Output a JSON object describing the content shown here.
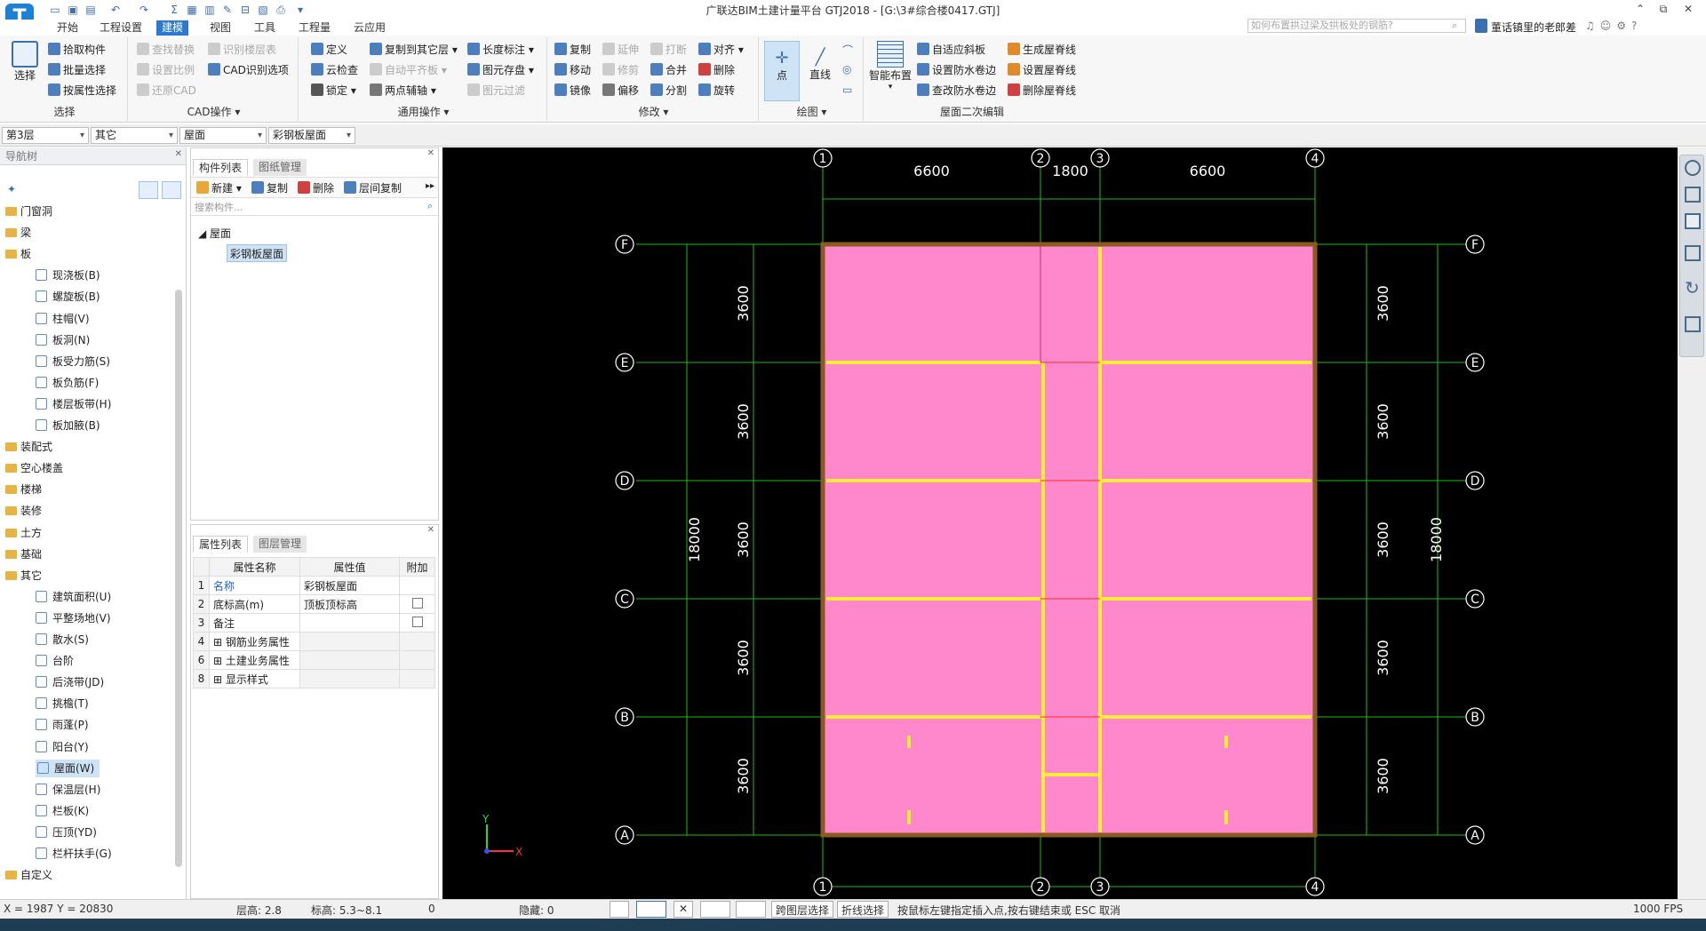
{
  "window": {
    "title": "广联达BIM土建计量平台 GTJ2018 - [G:\\3#综合楼0417.GTJ]"
  },
  "menu": [
    "开始",
    "工程设置",
    "建模",
    "视图",
    "工具",
    "工程量",
    "云应用"
  ],
  "menu_active_index": 2,
  "search": {
    "placeholder": "如何布置拱过梁及拱板处的钢筋?"
  },
  "user": {
    "name": "董话镇里的老郎差"
  },
  "ribbon": {
    "select": {
      "label": "选择",
      "big": "选择",
      "items": [
        "拾取构件",
        "批量选择",
        "按属性选择"
      ]
    },
    "cad": {
      "label": "CAD操作",
      "items": [
        "查找替换",
        "设置比例",
        "还原CAD",
        "识别楼层表",
        "CAD识别选项"
      ]
    },
    "common": {
      "label": "通用操作",
      "items": [
        "定义",
        "云检查",
        "锁定",
        "复制到其它层",
        "自动平齐板",
        "两点辅轴",
        "长度标注",
        "图元存盘",
        "图元过滤"
      ]
    },
    "modify": {
      "label": "修改",
      "items": [
        "复制",
        "移动",
        "镜像",
        "延伸",
        "修剪",
        "偏移",
        "打断",
        "合并",
        "分割",
        "对齐",
        "删除",
        "旋转"
      ]
    },
    "draw": {
      "label": "绘图",
      "items": [
        "点",
        "直线"
      ]
    },
    "roof": {
      "label": "屋面二次编辑",
      "items": [
        "智能布置",
        "自适应斜板",
        "设置防水卷边",
        "查改防水卷边",
        "生成屋脊线",
        "设置屋脊线",
        "删除屋脊线"
      ]
    }
  },
  "filters": [
    "第3层",
    "其它",
    "屋面",
    "彩钢板屋面"
  ],
  "nav": {
    "title": "导航树",
    "items": [
      {
        "t": "folder",
        "label": "门窗洞"
      },
      {
        "t": "folder",
        "label": "梁"
      },
      {
        "t": "folder",
        "label": "板"
      },
      {
        "t": "leaf",
        "label": "现浇板(B)"
      },
      {
        "t": "leaf",
        "label": "螺旋板(B)"
      },
      {
        "t": "leaf",
        "label": "柱帽(V)"
      },
      {
        "t": "leaf",
        "label": "板洞(N)"
      },
      {
        "t": "leaf",
        "label": "板受力筋(S)"
      },
      {
        "t": "leaf",
        "label": "板负筋(F)"
      },
      {
        "t": "leaf",
        "label": "楼层板带(H)"
      },
      {
        "t": "leaf",
        "label": "板加腋(B)"
      },
      {
        "t": "folder",
        "label": "装配式"
      },
      {
        "t": "folder",
        "label": "空心楼盖"
      },
      {
        "t": "folder",
        "label": "楼梯"
      },
      {
        "t": "folder",
        "label": "装修"
      },
      {
        "t": "folder",
        "label": "土方"
      },
      {
        "t": "folder",
        "label": "基础"
      },
      {
        "t": "folder",
        "label": "其它"
      },
      {
        "t": "leaf",
        "label": "建筑面积(U)"
      },
      {
        "t": "leaf",
        "label": "平整场地(V)"
      },
      {
        "t": "leaf",
        "label": "散水(S)"
      },
      {
        "t": "leaf",
        "label": "台阶"
      },
      {
        "t": "leaf",
        "label": "后浇带(JD)"
      },
      {
        "t": "leaf",
        "label": "挑檐(T)"
      },
      {
        "t": "leaf",
        "label": "雨蓬(P)"
      },
      {
        "t": "leaf",
        "label": "阳台(Y)"
      },
      {
        "t": "leaf",
        "label": "屋面(W)",
        "selected": true
      },
      {
        "t": "leaf",
        "label": "保温层(H)"
      },
      {
        "t": "leaf",
        "label": "栏板(K)"
      },
      {
        "t": "leaf",
        "label": "压顶(YD)"
      },
      {
        "t": "leaf",
        "label": "栏杆扶手(G)"
      },
      {
        "t": "folder",
        "label": "自定义"
      }
    ]
  },
  "components": {
    "tabs": [
      "构件列表",
      "图纸管理"
    ],
    "toolbar": [
      "新建",
      "复制",
      "删除",
      "层间复制"
    ],
    "search_placeholder": "搜索构件...",
    "group": "屋面",
    "selected": "彩钢板屋面"
  },
  "attributes": {
    "tabs": [
      "属性列表",
      "图层管理"
    ],
    "headers": [
      "属性名称",
      "属性值",
      "附加"
    ],
    "rows": [
      {
        "n": "1",
        "name": "名称",
        "value": "彩钢板屋面",
        "check": false,
        "blue": true
      },
      {
        "n": "2",
        "name": "底标高(m)",
        "value": "顶板顶标高",
        "check": true
      },
      {
        "n": "3",
        "name": "备注",
        "value": "",
        "check": true
      },
      {
        "n": "4",
        "name": "钢筋业务属性",
        "value": "",
        "check": false,
        "expand": true
      },
      {
        "n": "6",
        "name": "土建业务属性",
        "value": "",
        "check": false,
        "expand": true
      },
      {
        "n": "8",
        "name": "显示样式",
        "value": "",
        "check": false,
        "expand": true
      }
    ]
  },
  "drawing": {
    "axes_x": [
      "1",
      "2",
      "3",
      "4"
    ],
    "axes_y": [
      "F",
      "E",
      "D",
      "C",
      "B",
      "A"
    ],
    "dims_x": [
      "6600",
      "1800",
      "6600"
    ],
    "dims_y": [
      "3600",
      "3600",
      "3600",
      "3600",
      "3600"
    ],
    "total_y": "18000",
    "ucs": {
      "x": "X",
      "y": "Y"
    },
    "colors": {
      "roof": "#ff88cc",
      "beam": "#ffee33",
      "grid": "#18c018",
      "edge": "#8a5a20"
    }
  },
  "status": {
    "coords": "X = 1987 Y = 20830",
    "floor_h": "层高:  2.8",
    "elev": "标高:  5.3~8.1",
    "count": "0",
    "hidden": "隐藏:  0",
    "btn1": "跨图层选择",
    "btn2": "折线选择",
    "hint": "按鼠标左键指定插入点,按右键结束或 ESC 取消",
    "fps": "1000 FPS"
  }
}
